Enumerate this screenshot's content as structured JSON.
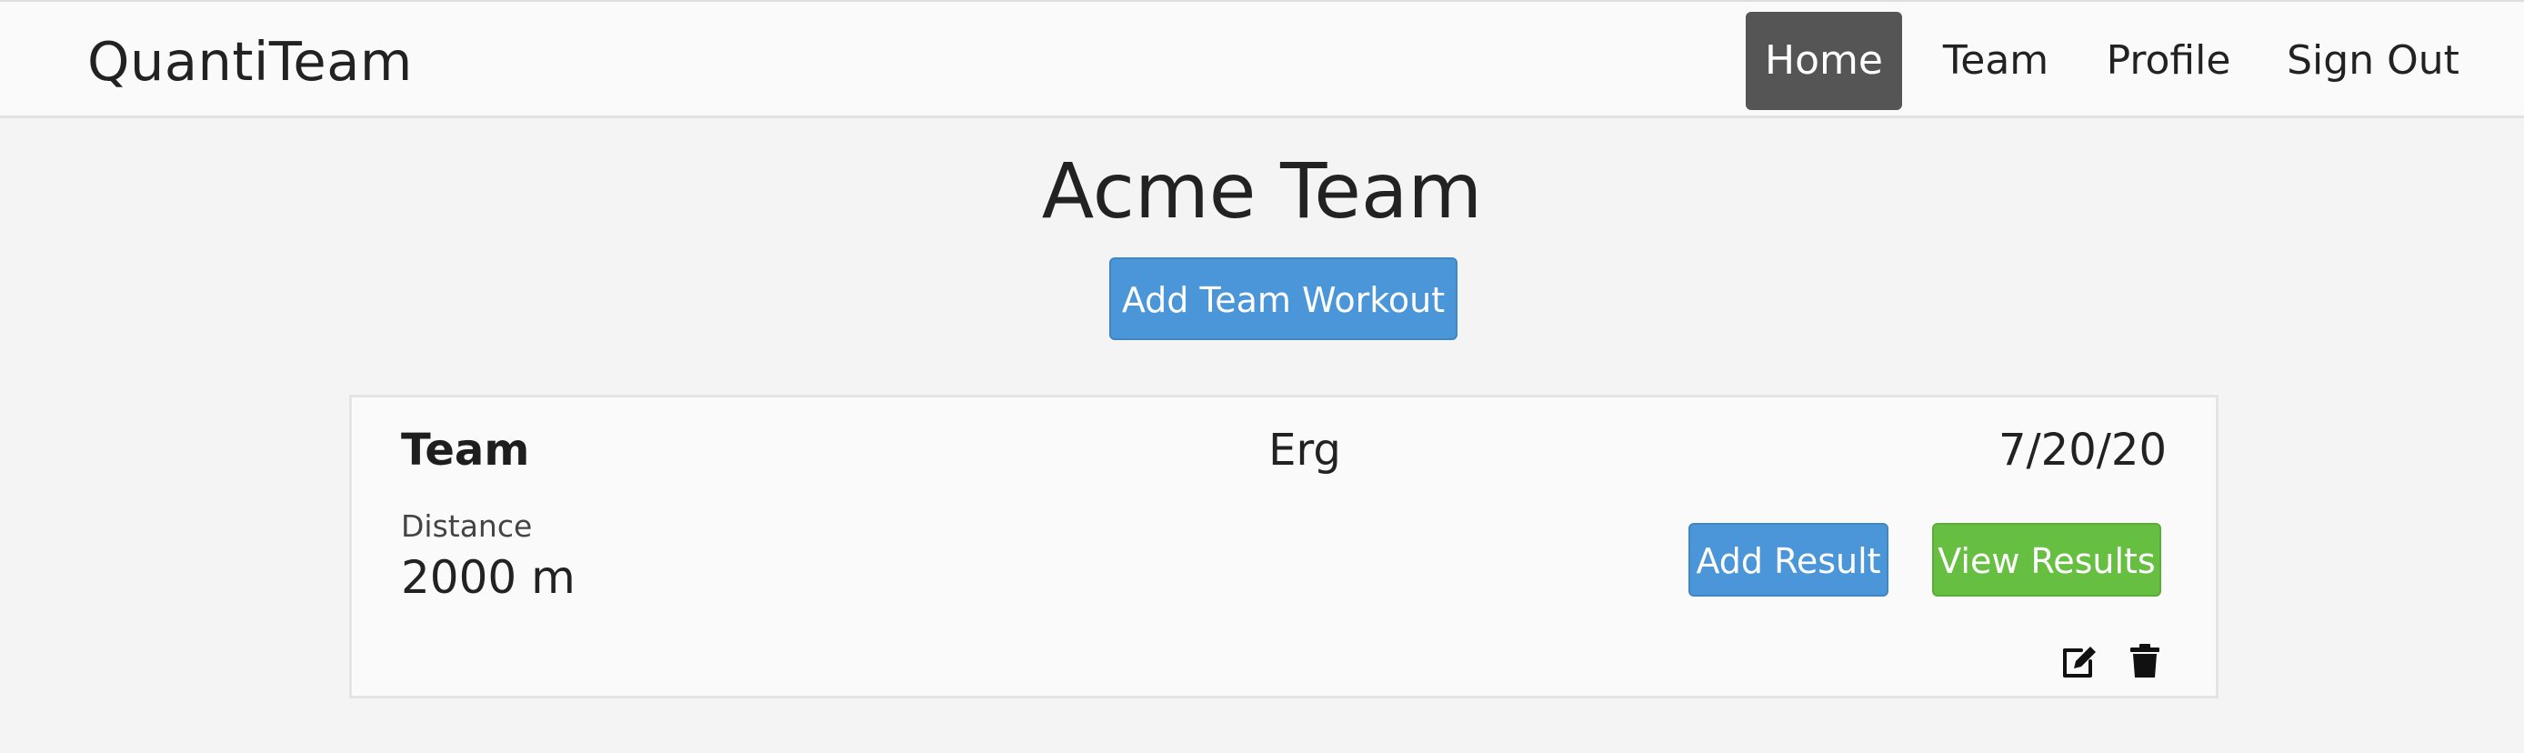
{
  "app": {
    "brand": "QuantiTeam"
  },
  "nav": {
    "items": [
      {
        "label": "Home",
        "active": true
      },
      {
        "label": "Team",
        "active": false
      },
      {
        "label": "Profile",
        "active": false
      },
      {
        "label": "Sign Out",
        "active": false
      }
    ]
  },
  "page": {
    "title": "Acme Team",
    "add_workout_label": "Add Team Workout"
  },
  "workout": {
    "type": "Team",
    "category": "Erg",
    "date": "7/20/20",
    "metric_label": "Distance",
    "metric_value": "2000 m",
    "add_result_label": "Add Result",
    "view_results_label": "View Results",
    "edit_icon": "edit-icon",
    "delete_icon": "trash-icon"
  },
  "colors": {
    "nav_active_bg": "#555555",
    "primary": "#4a96d8",
    "success": "#67bf42",
    "page_bg": "#f4f4f4",
    "card_bg": "#fafafa"
  }
}
